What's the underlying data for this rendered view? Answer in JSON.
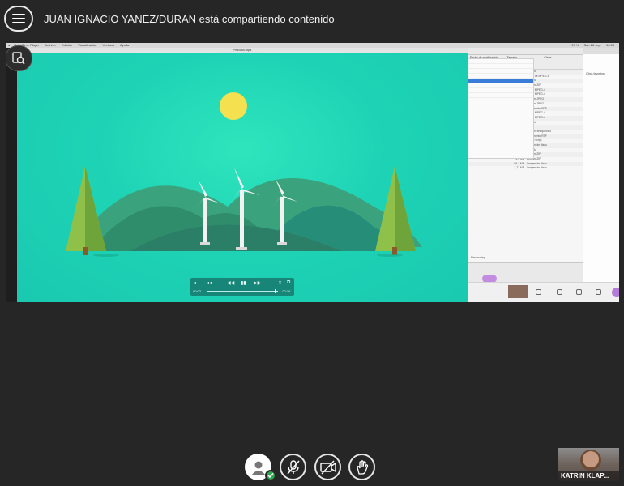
{
  "header": {
    "title": "JUAN IGNACIO YANEZ/DURAN está compartiendo contenido"
  },
  "shared_screen": {
    "mac_menubar": {
      "items": [
        "QuickTime Player",
        "Archivo",
        "Edición",
        "Visualización",
        "Ventana",
        "Ayuda"
      ],
      "status": [
        "99 %",
        "Sab 26 sep.",
        "10:58"
      ]
    },
    "player": {
      "window_title": "Pelicula.mp4",
      "time_elapsed": "00:02",
      "time_remaining": "-02:16"
    },
    "finder": {
      "columns": [
        "Fecha de modificación",
        "Tamaño",
        "Clase"
      ],
      "rows": [
        {
          "size": "",
          "kind": "Carpeta"
        },
        {
          "size": "15,1 MB",
          "kind": "Vídeo de MPEG-4"
        },
        {
          "size": "",
          "kind": "Carpeta"
        },
        {
          "size": "763 KB",
          "kind": "Archivo ZIP"
        },
        {
          "size": "31,1 MB",
          "kind": "Vídeo MPEG-4"
        },
        {
          "size": "42,1 MB",
          "kind": "Vídeo MPEG-4"
        },
        {
          "size": "1,96 MB",
          "kind": "Imagen JPEG"
        },
        {
          "size": "44 KB",
          "kind": "Imagen JPEG"
        },
        {
          "size": "15,2 MB",
          "kind": "Documento PDF"
        },
        {
          "size": "10,2 MB",
          "kind": "Vídeo MPEG-4"
        },
        {
          "size": "45,6 MB",
          "kind": "Vídeo MPEG-4"
        },
        {
          "size": "",
          "kind": "Carpeta"
        },
        {
          "size": "99 bytes",
          "kind": "Texto"
        },
        {
          "size": "27,1 MB",
          "kind": "Docum. enriquecido"
        },
        {
          "size": "45 KB",
          "kind": "Documento RTF"
        },
        {
          "size": "1 KB",
          "kind": "Grupo script"
        },
        {
          "size": "10,7 MB",
          "kind": "Imagen de disco"
        },
        {
          "size": "",
          "kind": "Carpeta"
        },
        {
          "size": "1,4 MB",
          "kind": "Archivo ZIP"
        },
        {
          "size": "1,7 MB",
          "kind": "Archivo ZIP"
        },
        {
          "size": "95,1 MB",
          "kind": "Imagen de disco"
        },
        {
          "size": "1,71 MB",
          "kind": "Imagen de disco"
        }
      ],
      "link_text": "Recording"
    },
    "browser": {
      "items": [
        "Otros favoritos"
      ]
    }
  },
  "toolbar": {
    "buttons": [
      {
        "name": "user-status-button",
        "icon": "user-icon"
      },
      {
        "name": "mute-button",
        "icon": "microphone-off-icon"
      },
      {
        "name": "camera-button",
        "icon": "camera-off-icon"
      },
      {
        "name": "raise-hand-button",
        "icon": "hand-icon"
      }
    ]
  },
  "participant": {
    "name": "KATRIN KLAP..."
  },
  "colors": {
    "background": "#262626",
    "video_teal": "#1ed3b5",
    "sun": "#f5e050",
    "tree": "#8fc049",
    "status_green": "#2ea44f"
  }
}
